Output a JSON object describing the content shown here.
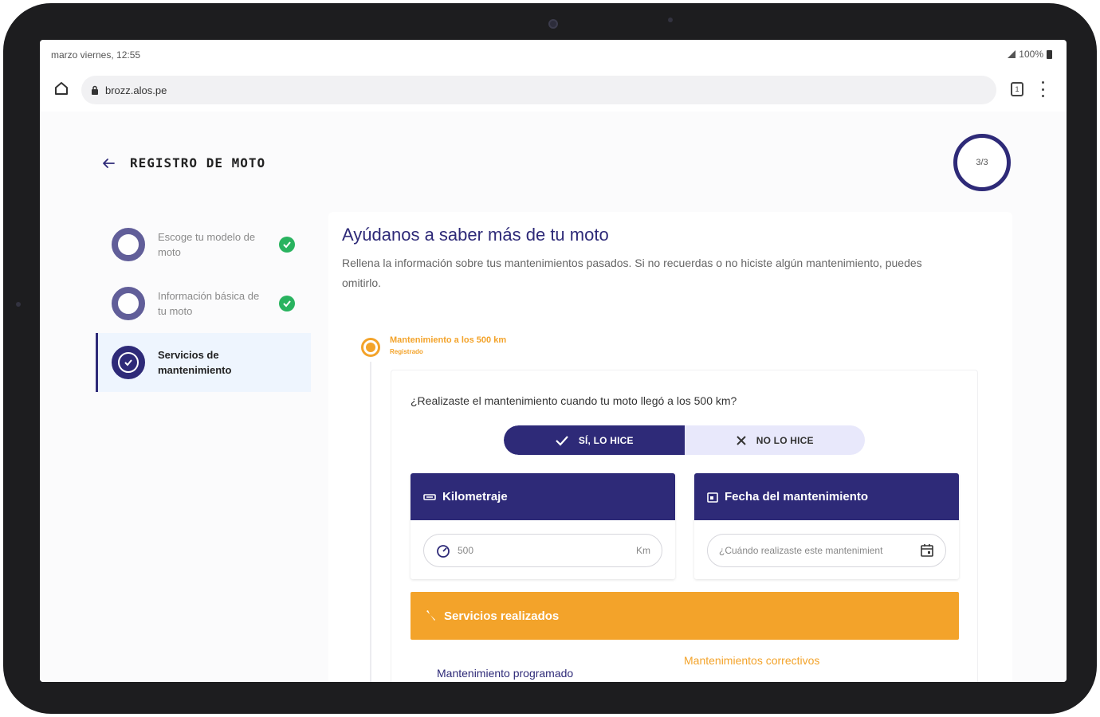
{
  "status": {
    "time": "marzo viernes, 12:55",
    "battery": "100%"
  },
  "browser": {
    "url": "brozz.alos.pe",
    "tabs_count": "1"
  },
  "header": {
    "title": "REGISTRO DE MOTO",
    "progress": "3/3"
  },
  "stepper": {
    "steps": [
      {
        "label": "Escoge tu modelo de moto",
        "done": true
      },
      {
        "label": "Información básica de tu moto",
        "done": true
      },
      {
        "label": "Servicios de mantenimiento",
        "active": true
      }
    ]
  },
  "main": {
    "title": "Ayúdanos a saber más de tu moto",
    "description": "Rellena la información sobre tus mantenimientos pasados. Si no recuerdas o no hiciste algún mantenimiento, puedes omitirlo.",
    "milestone": {
      "title": "Mantenimiento a los 500 km",
      "subtitle": "Registrado"
    },
    "question": "¿Realizaste el mantenimiento cuando tu moto llegó a los 500 km?",
    "toggle": {
      "yes_label": "SÍ, LO HICE",
      "no_label": "NO LO HICE",
      "selected": "yes"
    },
    "mileage": {
      "label": "Kilometraje",
      "value": "500",
      "unit": "Km"
    },
    "date": {
      "label": "Fecha del mantenimiento",
      "placeholder": "¿Cuándo realizaste este mantenimient"
    },
    "services": {
      "label": "Servicios realizados",
      "scheduled_label": "Mantenimiento programado",
      "corrective_label": "Mantenimientos correctivos"
    }
  },
  "colors": {
    "primary": "#2e2a78",
    "accent": "#f3a32a",
    "success": "#29b35f"
  }
}
